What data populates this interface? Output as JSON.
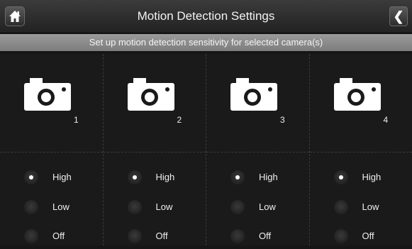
{
  "header": {
    "title": "Motion Detection Settings",
    "home_icon": "home-icon",
    "back_icon": "back-arrow-icon",
    "back_glyph": "❮"
  },
  "subtitle": "Set up motion detection sensitivity for selected camera(s)",
  "options": [
    "High",
    "Low",
    "Off"
  ],
  "cameras": [
    {
      "number": "1",
      "selected": "High"
    },
    {
      "number": "2",
      "selected": "High"
    },
    {
      "number": "3",
      "selected": "High"
    },
    {
      "number": "4",
      "selected": "High"
    }
  ]
}
